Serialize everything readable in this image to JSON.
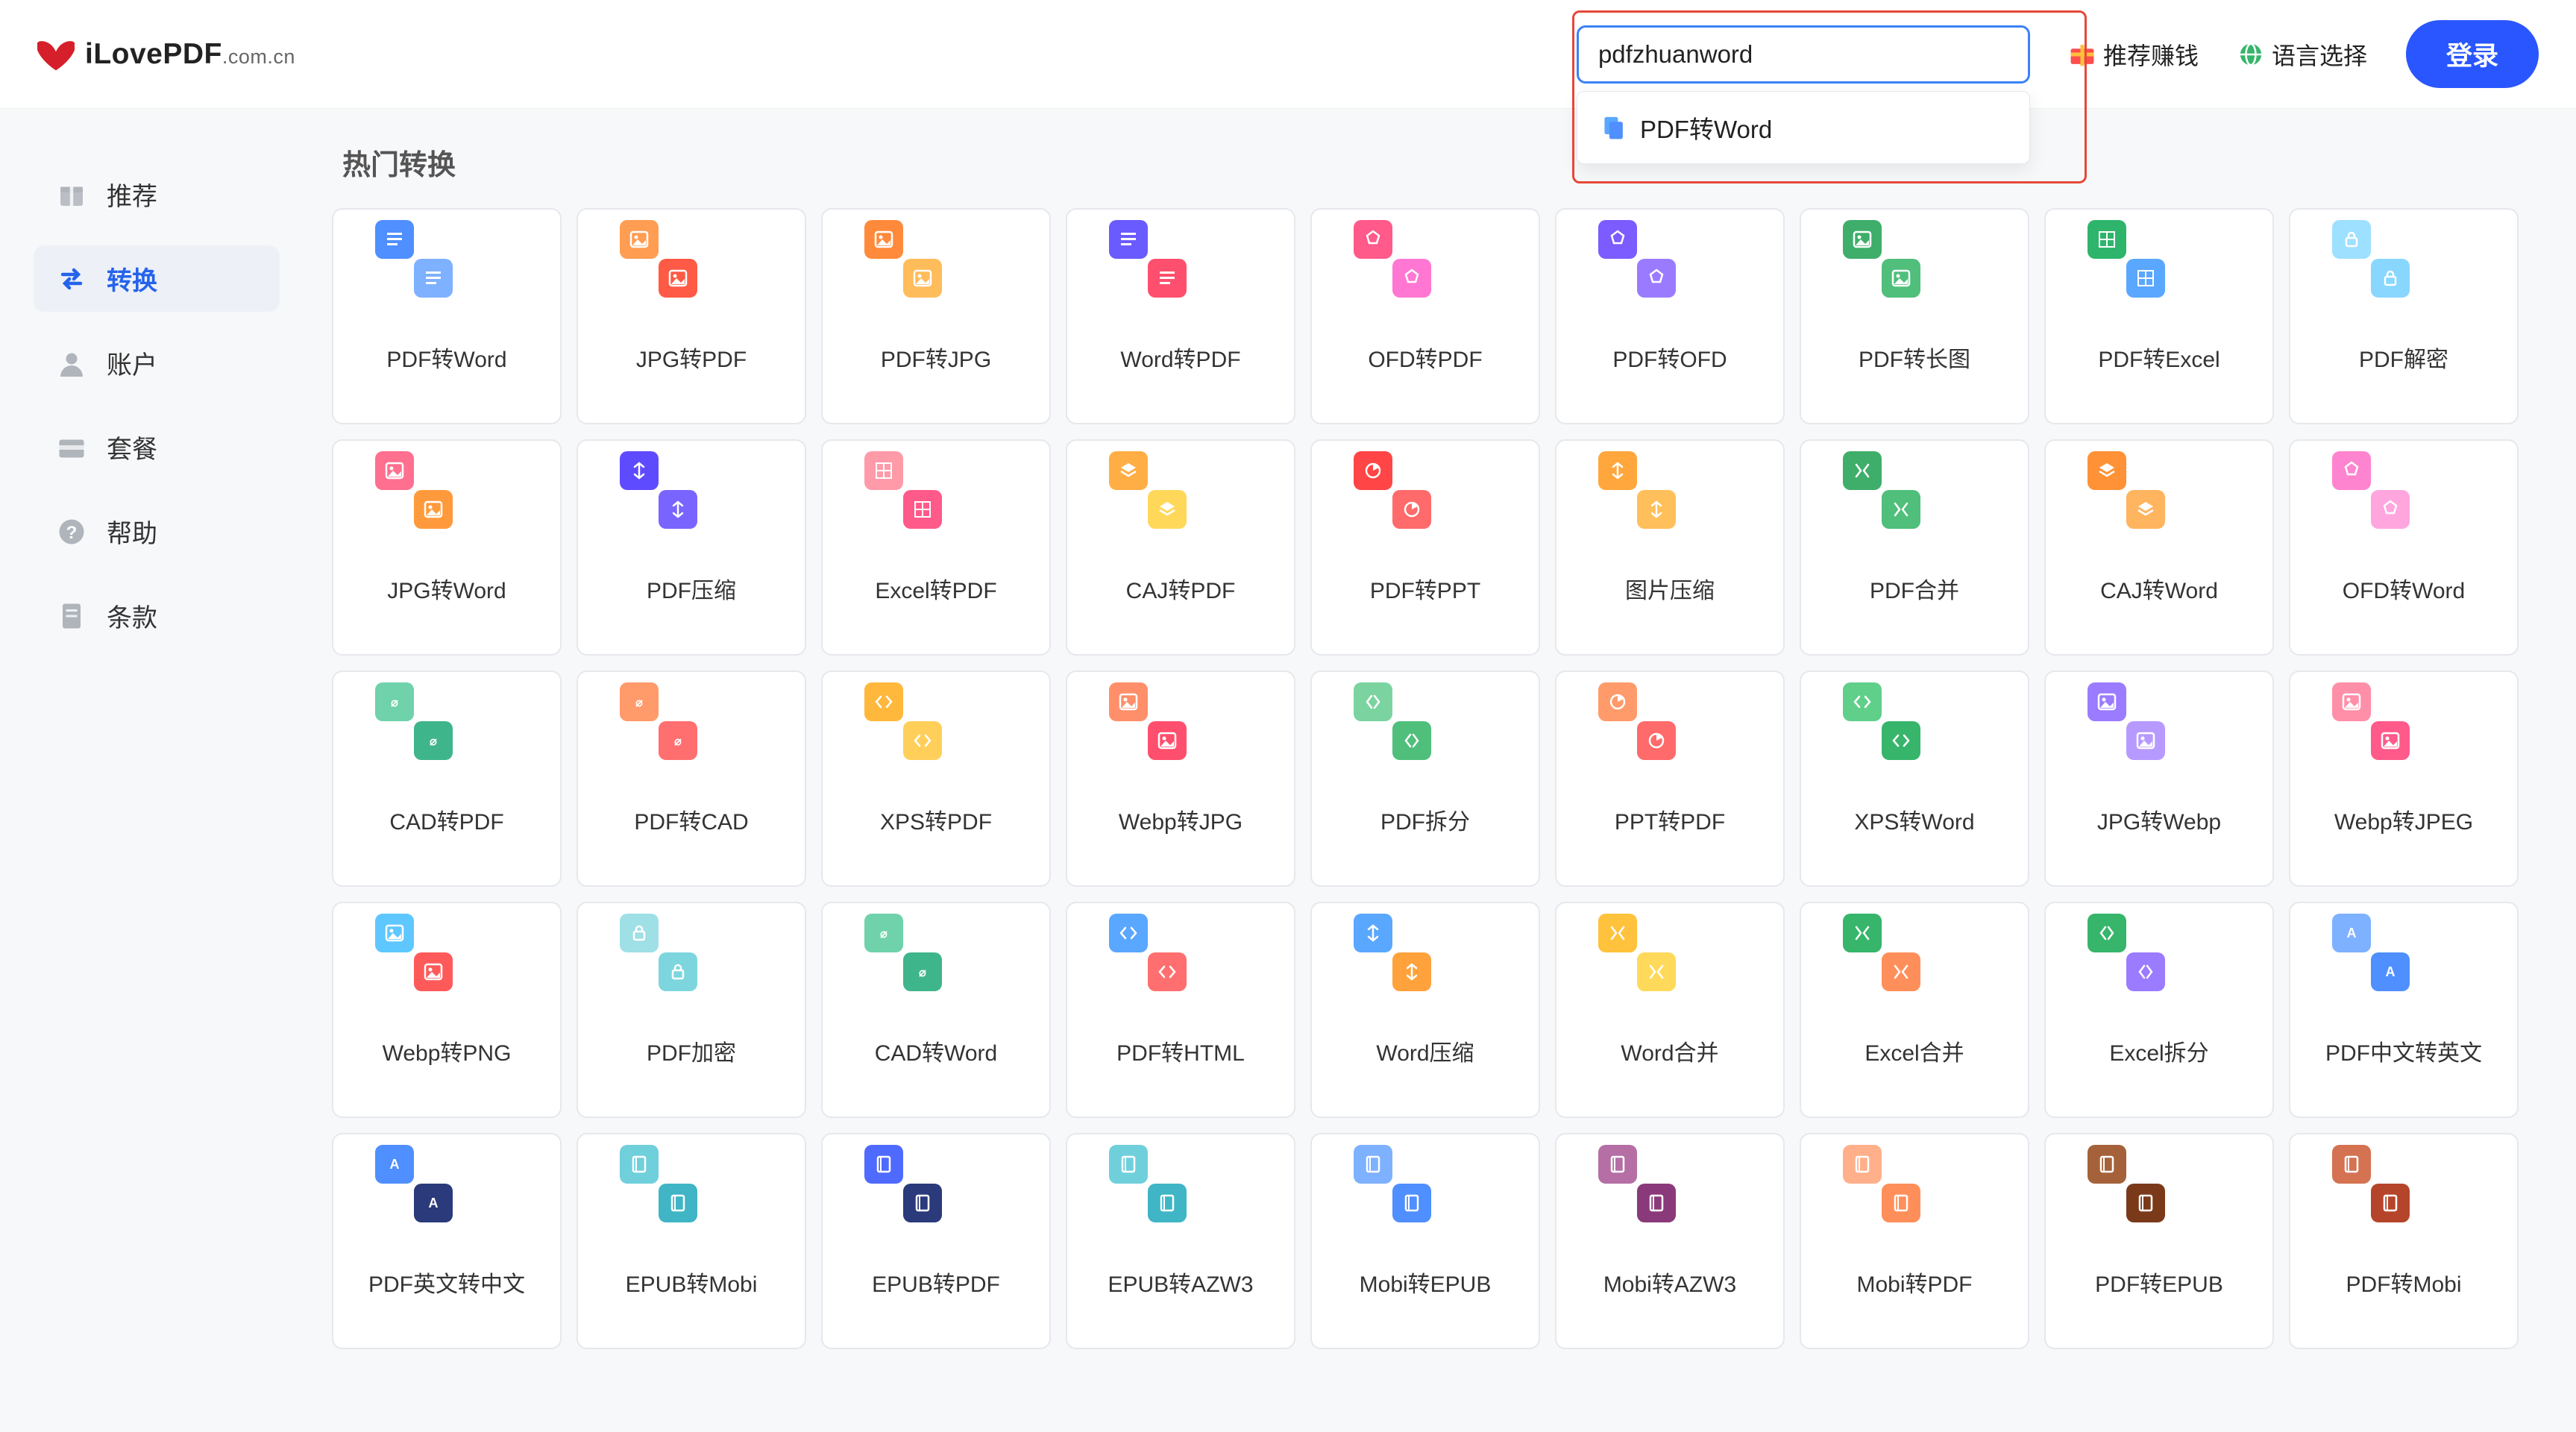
{
  "header": {
    "brand_main": "iLovePDF",
    "brand_suffix": ".com.cn",
    "search_value": "pdfzhuanword",
    "dropdown": [
      {
        "label": "PDF转Word",
        "icon": "doc-icon"
      }
    ],
    "referral": "推荐赚钱",
    "language": "语言选择",
    "login": "登录"
  },
  "sidebar": [
    {
      "key": "recommend",
      "icon": "gift-icon",
      "label": "推荐",
      "active": false
    },
    {
      "key": "convert",
      "icon": "swap-icon",
      "label": "转换",
      "active": true
    },
    {
      "key": "account",
      "icon": "user-icon",
      "label": "账户",
      "active": false
    },
    {
      "key": "plan",
      "icon": "card-icon",
      "label": "套餐",
      "active": false
    },
    {
      "key": "help",
      "icon": "help-icon",
      "label": "帮助",
      "active": false
    },
    {
      "key": "terms",
      "icon": "doc-icon",
      "label": "条款",
      "active": false
    }
  ],
  "section_title": "热门转换",
  "tools": [
    {
      "label": "PDF转Word",
      "back": "#7eb1ff",
      "front": "#4f8fff",
      "icon": "text"
    },
    {
      "label": "JPG转PDF",
      "back": "#ff5a45",
      "front": "#ff9d52",
      "icon": "image"
    },
    {
      "label": "PDF转JPG",
      "back": "#ffbc5a",
      "front": "#ff8a3c",
      "icon": "image"
    },
    {
      "label": "Word转PDF",
      "back": "#ff4f6e",
      "front": "#6a5bff",
      "icon": "text"
    },
    {
      "label": "OFD转PDF",
      "back": "#ff77d2",
      "front": "#ff5a8a",
      "icon": "ofd"
    },
    {
      "label": "PDF转OFD",
      "back": "#9a7bff",
      "front": "#7c5bff",
      "icon": "ofd"
    },
    {
      "label": "PDF转长图",
      "back": "#4fbf7b",
      "front": "#3fae6b",
      "icon": "image"
    },
    {
      "label": "PDF转Excel",
      "back": "#5aa7ff",
      "front": "#2fb56b",
      "icon": "grid"
    },
    {
      "label": "PDF解密",
      "back": "#89d7ff",
      "front": "#9ee0ff",
      "icon": "lock"
    },
    {
      "label": "JPG转Word",
      "back": "#ff9a3c",
      "front": "#ff6f8f",
      "icon": "image"
    },
    {
      "label": "PDF压缩",
      "back": "#7a64ff",
      "front": "#5f4bff",
      "icon": "compress"
    },
    {
      "label": "Excel转PDF",
      "back": "#ff5a8a",
      "front": "#ff9aa9",
      "icon": "grid"
    },
    {
      "label": "CAJ转PDF",
      "back": "#ffd85a",
      "front": "#ffae45",
      "icon": "layer"
    },
    {
      "label": "PDF转PPT",
      "back": "#ff6a6a",
      "front": "#ff4545",
      "icon": "pie"
    },
    {
      "label": "图片压缩",
      "back": "#ffbf5a",
      "front": "#ffa73c",
      "icon": "compress"
    },
    {
      "label": "PDF合并",
      "back": "#4fbf7b",
      "front": "#3fae6b",
      "icon": "merge"
    },
    {
      "label": "CAJ转Word",
      "back": "#ffb45f",
      "front": "#ff9236",
      "icon": "layer"
    },
    {
      "label": "OFD转Word",
      "back": "#ffa6df",
      "front": "#ff84cf",
      "icon": "ofd"
    },
    {
      "label": "CAD转PDF",
      "back": "#3fb58b",
      "front": "#6fd2aa",
      "icon": "cad"
    },
    {
      "label": "PDF转CAD",
      "back": "#ff6f6f",
      "front": "#ff9a6a",
      "icon": "cad"
    },
    {
      "label": "XPS转PDF",
      "back": "#ffcf5a",
      "front": "#ffb83c",
      "icon": "code"
    },
    {
      "label": "Webp转JPG",
      "back": "#ff4f6e",
      "front": "#ff8f6a",
      "icon": "image"
    },
    {
      "label": "PDF拆分",
      "back": "#4fbf7b",
      "front": "#7bd4a0",
      "icon": "split"
    },
    {
      "label": "PPT转PDF",
      "back": "#ff6a6a",
      "front": "#ff9a6a",
      "icon": "pie"
    },
    {
      "label": "XPS转Word",
      "back": "#36b56b",
      "front": "#5fcf8a",
      "icon": "code"
    },
    {
      "label": "JPG转Webp",
      "back": "#b79aff",
      "front": "#9b7bff",
      "icon": "image"
    },
    {
      "label": "Webp转JPEG",
      "back": "#ff5a8a",
      "front": "#ff8fa8",
      "icon": "image"
    },
    {
      "label": "Webp转PNG",
      "back": "#ff5a5a",
      "front": "#5fc7ff",
      "icon": "image"
    },
    {
      "label": "PDF加密",
      "back": "#7dd6dd",
      "front": "#9ee0e6",
      "icon": "lock"
    },
    {
      "label": "CAD转Word",
      "back": "#3fb58b",
      "front": "#6fd2aa",
      "icon": "cad"
    },
    {
      "label": "PDF转HTML",
      "back": "#ff6f6f",
      "front": "#5aa7ff",
      "icon": "code"
    },
    {
      "label": "Word压缩",
      "back": "#ffa23c",
      "front": "#5aa7ff",
      "icon": "compress"
    },
    {
      "label": "Word合并",
      "back": "#ffd95a",
      "front": "#ffc23c",
      "icon": "merge"
    },
    {
      "label": "Excel合并",
      "back": "#ff8f5a",
      "front": "#36b56b",
      "icon": "merge"
    },
    {
      "label": "Excel拆分",
      "back": "#9b7bff",
      "front": "#36b56b",
      "icon": "split"
    },
    {
      "label": "PDF中文转英文",
      "back": "#4f8fff",
      "front": "#7eb1ff",
      "icon": "lang"
    },
    {
      "label": "PDF英文转中文",
      "back": "#2a3a7a",
      "front": "#4f8fff",
      "icon": "lang"
    },
    {
      "label": "EPUB转Mobi",
      "back": "#3fb5c5",
      "front": "#6fd0dc",
      "icon": "book"
    },
    {
      "label": "EPUB转PDF",
      "back": "#2a3a7a",
      "front": "#4f6aff",
      "icon": "book"
    },
    {
      "label": "EPUB转AZW3",
      "back": "#3fb5c5",
      "front": "#6fd0dc",
      "icon": "book"
    },
    {
      "label": "Mobi转EPUB",
      "back": "#4f8fff",
      "front": "#7eb1ff",
      "icon": "book"
    },
    {
      "label": "Mobi转AZW3",
      "back": "#8a3a7a",
      "front": "#b56fa5",
      "icon": "book"
    },
    {
      "label": "Mobi转PDF",
      "back": "#ff8f5a",
      "front": "#ffb08a",
      "icon": "book"
    },
    {
      "label": "PDF转EPUB",
      "back": "#7a3a1a",
      "front": "#a5623a",
      "icon": "book"
    },
    {
      "label": "PDF转Mobi",
      "back": "#b5452a",
      "front": "#d47252",
      "icon": "book"
    }
  ],
  "colors": {
    "primary": "#2956ff",
    "border": "#e6e8ec",
    "highlight": "#e54838"
  }
}
